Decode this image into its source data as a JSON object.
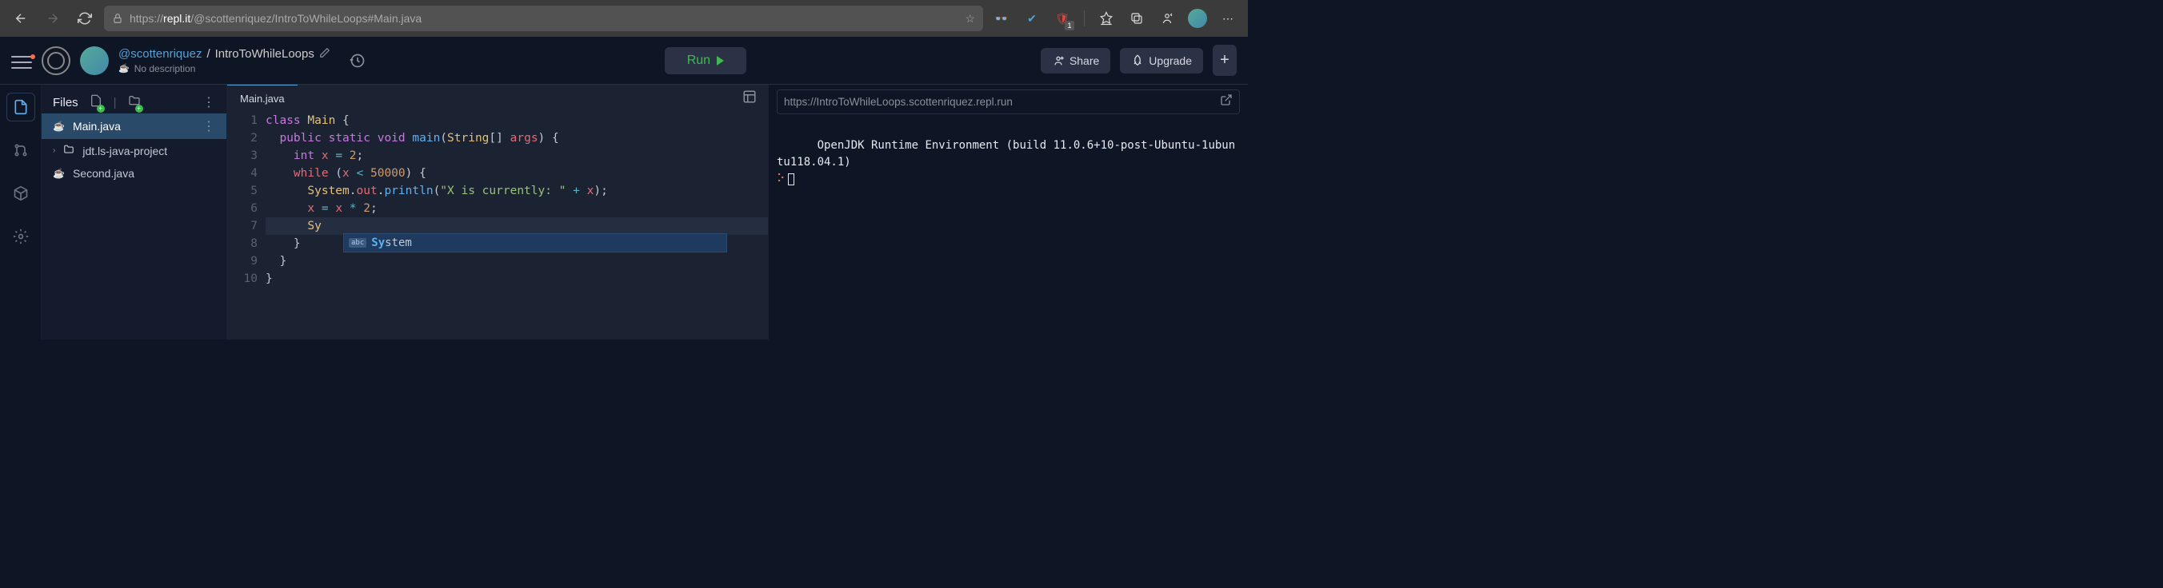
{
  "browser": {
    "url_prefix": "https://",
    "url_host": "repl.it",
    "url_path": "/@scottenriquez/IntroToWhileLoops#Main.java",
    "ext_badge": "1"
  },
  "header": {
    "owner": "@scottenriquez",
    "sep": "/",
    "project": "IntroToWhileLoops",
    "description": "No description",
    "run": "Run",
    "share": "Share",
    "upgrade": "Upgrade"
  },
  "files": {
    "title": "Files",
    "items": [
      {
        "name": "Main.java",
        "type": "file",
        "active": true
      },
      {
        "name": "jdt.ls-java-project",
        "type": "folder"
      },
      {
        "name": "Second.java",
        "type": "file"
      }
    ]
  },
  "editor": {
    "tab": "Main.java",
    "lines": [
      "1",
      "2",
      "3",
      "4",
      "5",
      "6",
      "7",
      "8",
      "9",
      "10"
    ],
    "autocomplete": {
      "icon": "abc",
      "match": "Sy",
      "rest": "stem"
    }
  },
  "output": {
    "url": "https://IntroToWhileLoops.scottenriquez.repl.run",
    "line1": "OpenJDK Runtime Environment (build 11.0.6+10-post-Ubuntu-1ubuntu118.04.1)",
    "prompt": "⠕"
  }
}
